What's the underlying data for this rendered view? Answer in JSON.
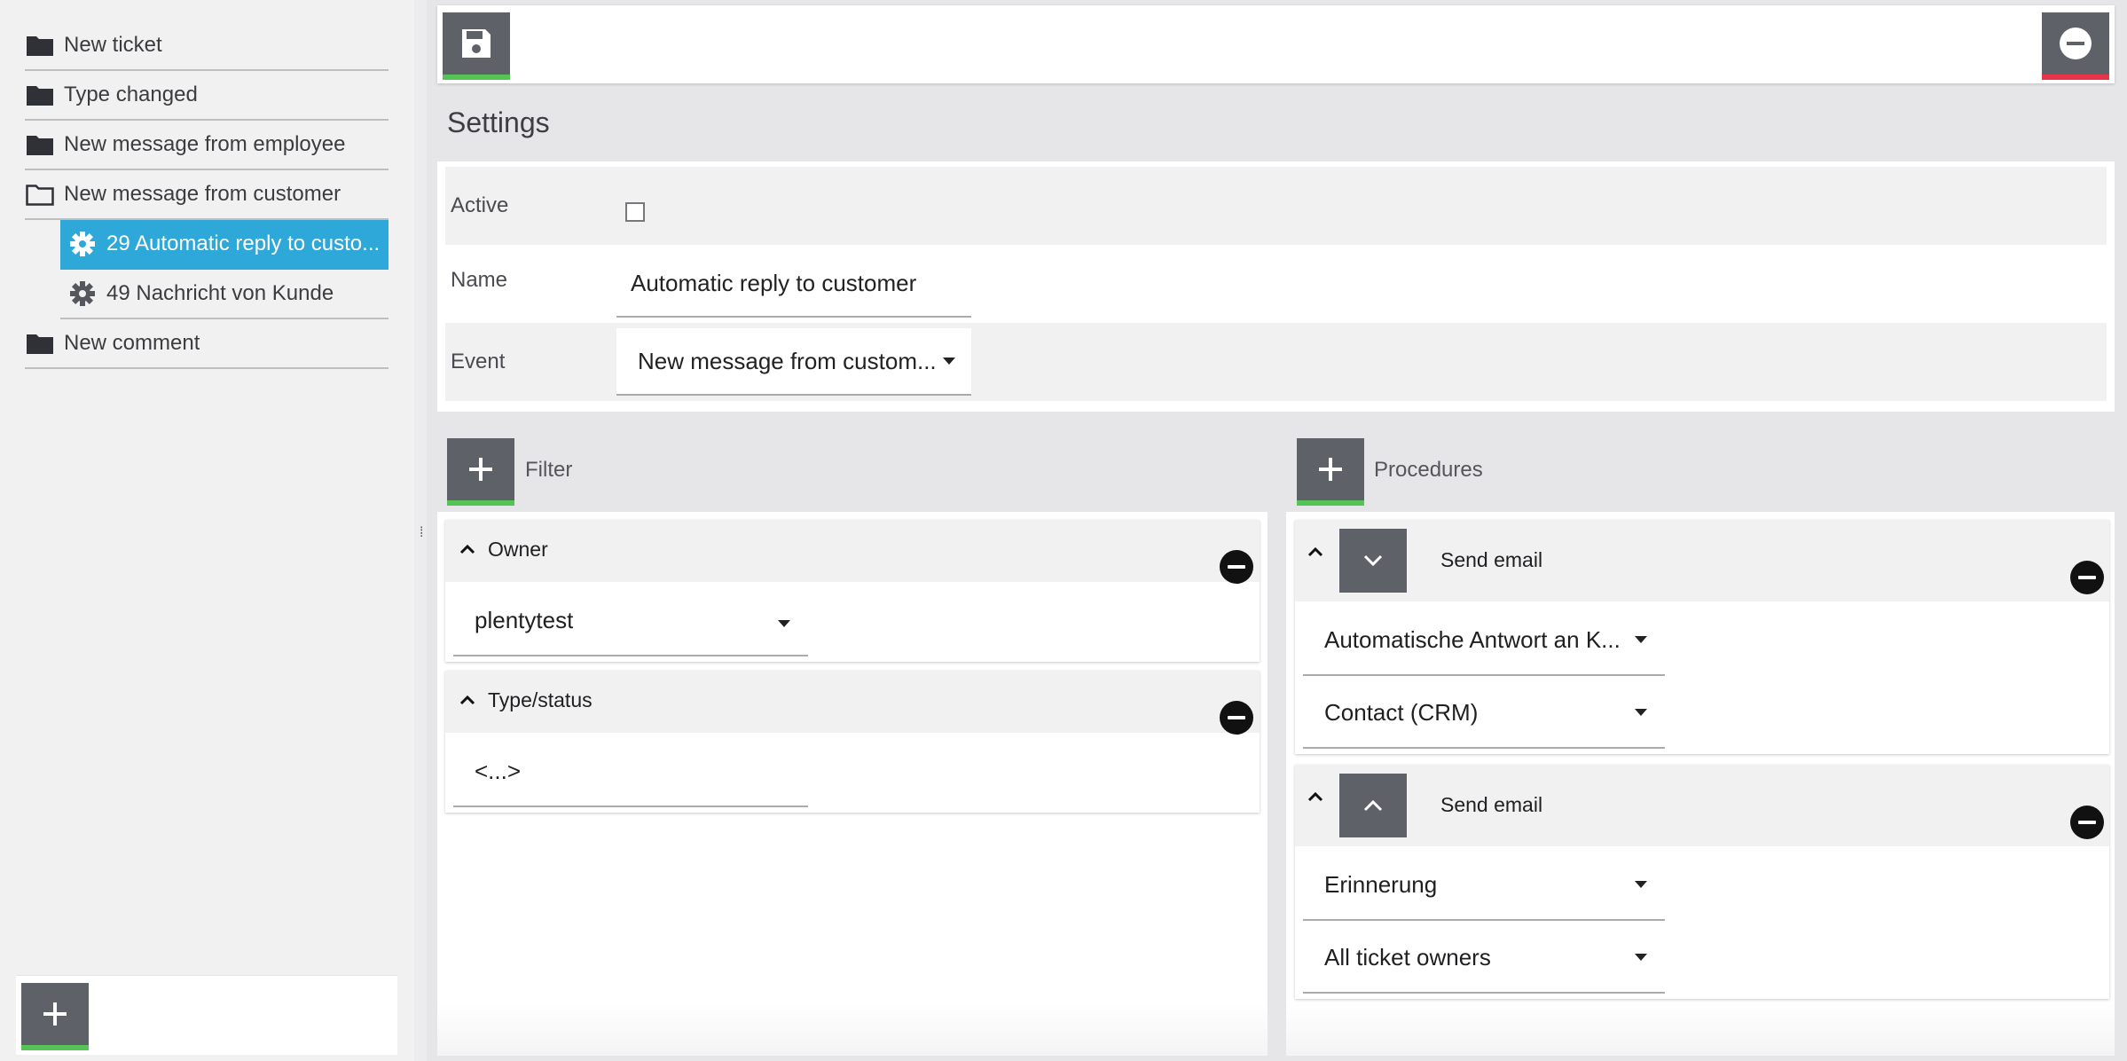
{
  "sidebar": {
    "items": [
      {
        "label": "New ticket",
        "icon": "folder-closed-icon"
      },
      {
        "label": "Type changed",
        "icon": "folder-closed-icon"
      },
      {
        "label": "New message from employee",
        "icon": "folder-closed-icon"
      },
      {
        "label": "New message from customer",
        "icon": "folder-open-icon"
      },
      {
        "label": "29 Automatic reply to custo...",
        "icon": "gear-icon",
        "selected": true
      },
      {
        "label": "49 Nachricht von Kunde",
        "icon": "gear-icon"
      },
      {
        "label": "New comment",
        "icon": "folder-closed-icon"
      }
    ],
    "add_icon": "plus-icon"
  },
  "toolbar": {
    "save_icon": "floppy-disk-icon",
    "delete_icon": "minus-circle-icon"
  },
  "settings": {
    "title": "Settings",
    "active_label": "Active",
    "active_checked": false,
    "name_label": "Name",
    "name_value": "Automatic reply to customer",
    "event_label": "Event",
    "event_value": "New message from custom..."
  },
  "filter": {
    "title": "Filter",
    "groups": [
      {
        "title": "Owner",
        "value": "plentytest"
      },
      {
        "title": "Type/status",
        "value": "<...>"
      }
    ]
  },
  "procedures": {
    "title": "Procedures",
    "groups": [
      {
        "title": "Send email",
        "fields": [
          "Automatische Antwort an K...",
          "Contact (CRM)"
        ]
      },
      {
        "title": "Send email",
        "fields": [
          "Erinnerung",
          "All ticket owners"
        ]
      }
    ]
  },
  "colors": {
    "accent_selected": "#2ea8d9",
    "button_dark": "#5f6169",
    "ok_bar": "#56c356",
    "danger_bar": "#e8334a"
  }
}
